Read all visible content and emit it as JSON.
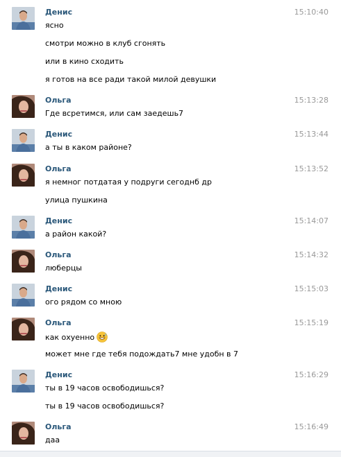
{
  "messages": [
    {
      "author": "Денис",
      "time": "15:10:40",
      "lines": [
        "ясно",
        "смотри можно в клуб сгонять",
        "или в кино сходить",
        "я готов на все ради такой милой девушки"
      ]
    },
    {
      "author": "Ольга",
      "time": "15:13:28",
      "lines": [
        "Где всретимся, или сам заедешь7"
      ]
    },
    {
      "author": "Денис",
      "time": "15:13:44",
      "lines": [
        "а ты в каком районе?"
      ]
    },
    {
      "author": "Ольга",
      "time": "15:13:52",
      "lines": [
        "я немног потдатая у подруги сегоднб др",
        "улица пушкина"
      ]
    },
    {
      "author": "Денис",
      "time": "15:14:07",
      "lines": [
        "а район какой?"
      ]
    },
    {
      "author": "Ольга",
      "time": "15:14:32",
      "lines": [
        "люберцы"
      ]
    },
    {
      "author": "Денис",
      "time": "15:15:03",
      "lines": [
        "ого рядом со мною"
      ]
    },
    {
      "author": "Ольга",
      "time": "15:15:19",
      "lines": [
        "как охуенно",
        "может мне где тебя подождать7 мне удобн в 7"
      ],
      "emoji": "grinning-sweat-emoji"
    },
    {
      "author": "Денис",
      "time": "15:16:29",
      "lines": [
        "ты в 19 часов освободишься?",
        "ты в 19 часов освободишься?"
      ]
    },
    {
      "author": "Ольга",
      "time": "15:16:49",
      "lines": [
        "даа"
      ]
    }
  ]
}
